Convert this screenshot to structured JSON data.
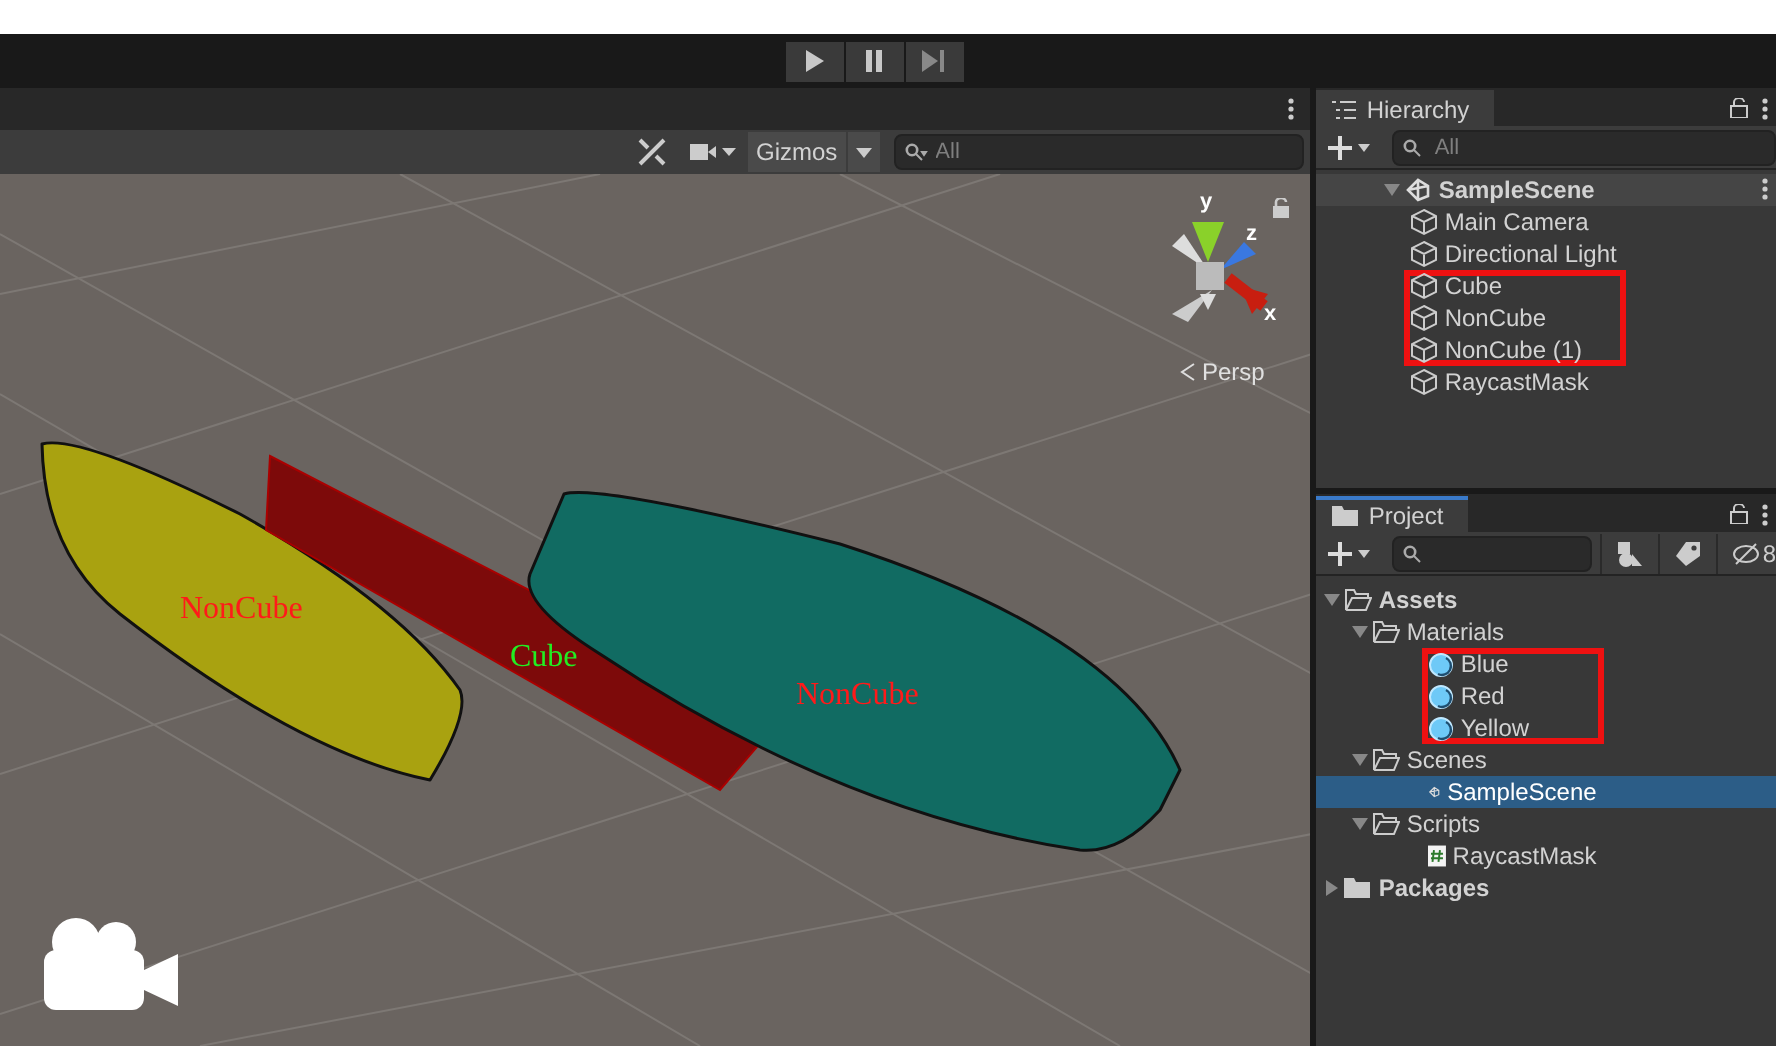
{
  "playbar": {
    "buttons": [
      {
        "kind": "play",
        "selected": false
      },
      {
        "kind": "pause",
        "selected": false
      },
      {
        "kind": "step",
        "selected": false
      }
    ]
  },
  "scene": {
    "toolbar": {
      "gizmos": "Gizmos",
      "search_placeholder": "All"
    },
    "gizmo": {
      "axes": [
        "y",
        "z",
        "x"
      ],
      "projection": "Persp"
    },
    "objects": [
      {
        "kind": "capsule",
        "label": "NonCube",
        "color": "#a9a210"
      },
      {
        "kind": "slab",
        "label": "Cube",
        "color": "#7d0a0a"
      },
      {
        "kind": "capsule",
        "label": "NonCube",
        "color": "#116b62"
      }
    ]
  },
  "hierarchy": {
    "title": "Hierarchy",
    "search_placeholder": "All",
    "tree": [
      {
        "label": "SampleScene",
        "kind": "scene",
        "expanded": true,
        "selected": false,
        "highlighted": false,
        "children": [
          {
            "label": "Main Camera",
            "kind": "object",
            "selected": false,
            "highlighted": false
          },
          {
            "label": "Directional Light",
            "kind": "object",
            "selected": false,
            "highlighted": false
          },
          {
            "label": "Cube",
            "kind": "object",
            "selected": false,
            "highlighted": true
          },
          {
            "label": "NonCube",
            "kind": "object",
            "selected": false,
            "highlighted": true
          },
          {
            "label": "NonCube (1)",
            "kind": "object",
            "selected": false,
            "highlighted": true
          },
          {
            "label": "RaycastMask",
            "kind": "object",
            "selected": false,
            "highlighted": false
          }
        ]
      }
    ]
  },
  "project": {
    "title": "Project",
    "hidden_count": "8",
    "tree": [
      {
        "label": "Assets",
        "kind": "folder",
        "expanded": true,
        "bold": true,
        "selected": false,
        "highlighted": false,
        "children": [
          {
            "label": "Materials",
            "kind": "folder",
            "expanded": true,
            "bold": false,
            "selected": false,
            "highlighted": false,
            "children": [
              {
                "label": "Blue",
                "kind": "material",
                "selected": false,
                "highlighted": true
              },
              {
                "label": "Red",
                "kind": "material",
                "selected": false,
                "highlighted": true
              },
              {
                "label": "Yellow",
                "kind": "material",
                "selected": false,
                "highlighted": true
              }
            ]
          },
          {
            "label": "Scenes",
            "kind": "folder",
            "expanded": true,
            "bold": false,
            "selected": false,
            "highlighted": false,
            "children": [
              {
                "label": "SampleScene",
                "kind": "scene",
                "selected": true,
                "highlighted": false
              }
            ]
          },
          {
            "label": "Scripts",
            "kind": "folder",
            "expanded": true,
            "bold": false,
            "selected": false,
            "highlighted": false,
            "children": [
              {
                "label": "RaycastMask",
                "kind": "script",
                "selected": false,
                "highlighted": false
              }
            ]
          }
        ]
      },
      {
        "label": "Packages",
        "kind": "folder",
        "expanded": false,
        "bold": true,
        "selected": false,
        "highlighted": false
      }
    ]
  }
}
